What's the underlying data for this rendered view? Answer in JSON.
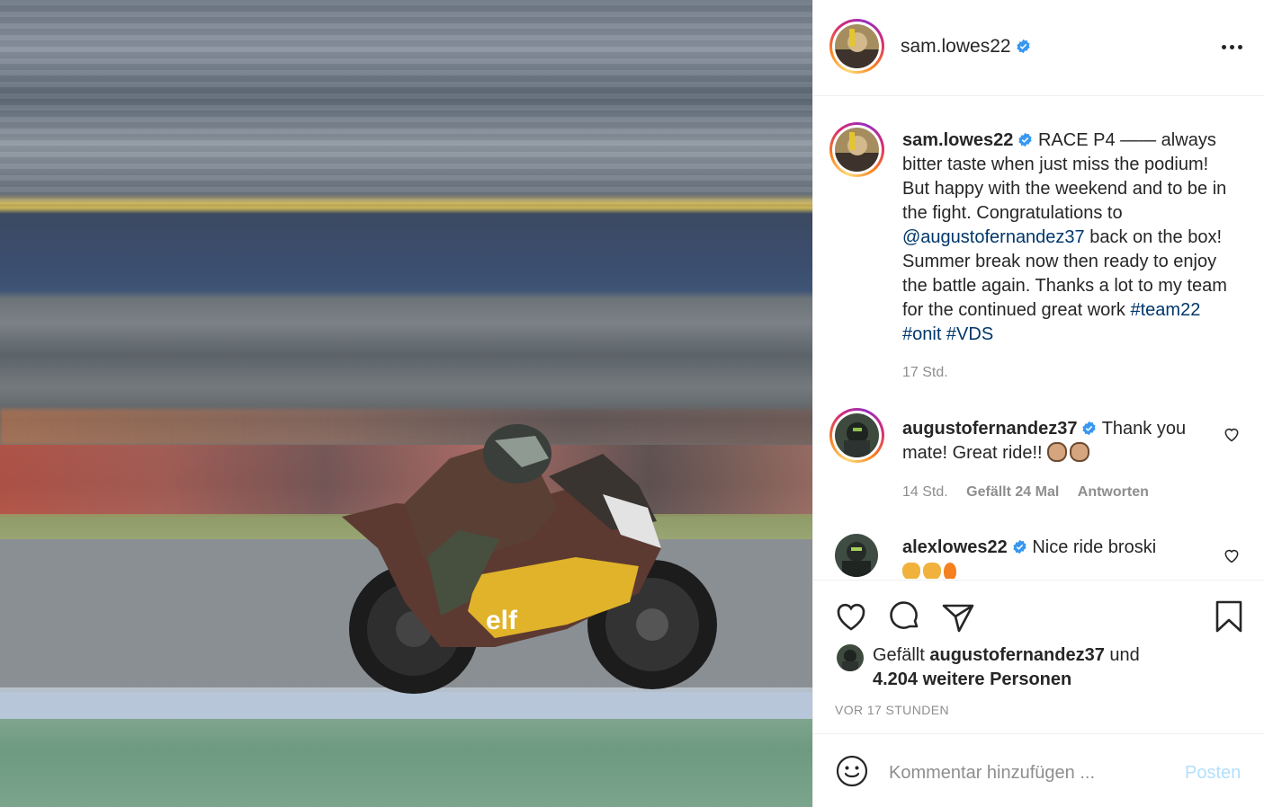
{
  "post": {
    "username": "sam.lowes22",
    "caption": {
      "part1": "RACE P4 —— always bitter taste when just miss the podium! But happy with the weekend and to be in the fight. Congratulations to ",
      "mention": "@augustofernandez37",
      "part2": " back on the box! Summer break now then ready to enjoy the battle again. Thanks a lot to my team for the continued great work ",
      "hashtags": "#team22 #onit #VDS",
      "time": "17 Std."
    }
  },
  "comments": [
    {
      "username": "augustofernandez37",
      "text": "Thank you mate! Great ride!! ",
      "emoji": [
        "fist-bump-emoji",
        "fist-bump-emoji"
      ],
      "time": "14 Std.",
      "likes": "Gefällt 24 Mal",
      "reply": "Antworten"
    },
    {
      "username": "alexlowes22",
      "text": "Nice ride broski",
      "emoji": [
        "clapping-hands-emoji",
        "clapping-hands-emoji",
        "fire-emoji"
      ]
    }
  ],
  "likes": {
    "prefix": "Gefällt ",
    "user": "augustofernandez37",
    "middle": " und",
    "others": "4.204 weitere Personen"
  },
  "timestamp": "VOR 17 STUNDEN",
  "add_comment": {
    "placeholder": "Kommentar hinzufügen ...",
    "post_label": "Posten"
  },
  "colors": {
    "verified": "#3897f0",
    "link": "#00376b",
    "muted": "#8e8e8e",
    "post_button": "#b2dffc"
  },
  "icons": {
    "options": "more-horizontal-icon",
    "like": "heart-icon",
    "comment": "comment-bubble-icon",
    "share": "paper-plane-icon",
    "save": "bookmark-icon",
    "emoji": "smiley-icon"
  }
}
